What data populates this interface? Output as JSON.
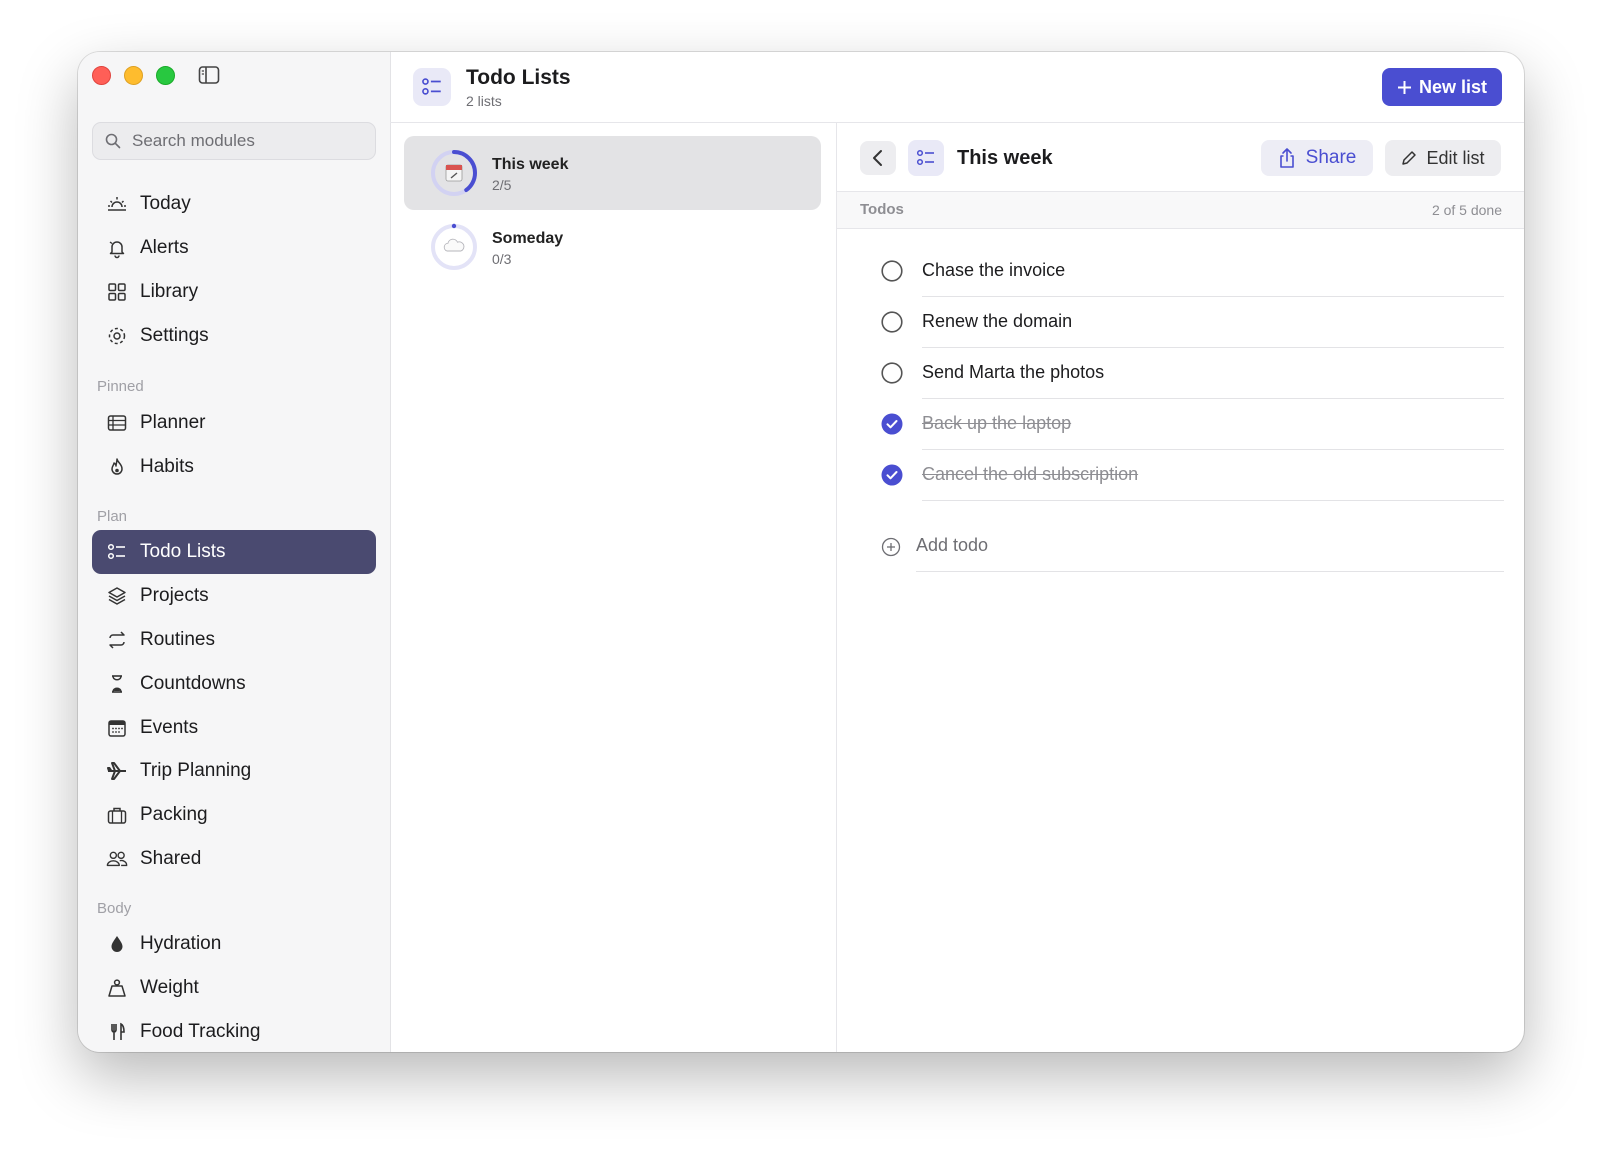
{
  "sidebar": {
    "search_placeholder": "Search modules",
    "top_items": [
      {
        "label": "Today",
        "icon": "sun-horizon-icon"
      },
      {
        "label": "Alerts",
        "icon": "bell-icon"
      },
      {
        "label": "Library",
        "icon": "grid-icon"
      },
      {
        "label": "Settings",
        "icon": "gear-icon"
      }
    ],
    "sections": {
      "pinned": "Pinned",
      "plan": "Plan",
      "body": "Body"
    },
    "pinned_items": [
      {
        "label": "Planner",
        "icon": "planner-icon"
      },
      {
        "label": "Habits",
        "icon": "flame-icon"
      }
    ],
    "plan_items": [
      {
        "label": "Todo Lists",
        "icon": "checklist-icon",
        "active": true
      },
      {
        "label": "Projects",
        "icon": "layers-icon"
      },
      {
        "label": "Routines",
        "icon": "repeat-icon"
      },
      {
        "label": "Countdowns",
        "icon": "hourglass-icon"
      },
      {
        "label": "Events",
        "icon": "calendar-icon"
      },
      {
        "label": "Trip Planning",
        "icon": "airplane-icon"
      },
      {
        "label": "Packing",
        "icon": "suitcase-icon"
      },
      {
        "label": "Shared",
        "icon": "people-icon"
      }
    ],
    "body_items": [
      {
        "label": "Hydration",
        "icon": "drop-icon"
      },
      {
        "label": "Weight",
        "icon": "weight-icon"
      },
      {
        "label": "Food Tracking",
        "icon": "fork-knife-icon"
      }
    ]
  },
  "header": {
    "title": "Todo Lists",
    "subtitle": "2 lists",
    "new_button": "New list",
    "accent": "#4a4ed1"
  },
  "lists": [
    {
      "name": "This week",
      "count": "2/5",
      "progress": 0.4,
      "selected": true
    },
    {
      "name": "Someday",
      "count": "0/3",
      "progress": 0.0,
      "selected": false
    }
  ],
  "detail": {
    "title": "This week",
    "share_label": "Share",
    "edit_label": "Edit list",
    "todos_label": "Todos",
    "done_summary": "2 of 5 done",
    "todos": [
      {
        "text": "Chase the invoice",
        "done": false
      },
      {
        "text": "Renew the domain",
        "done": false
      },
      {
        "text": "Send Marta the photos",
        "done": false
      },
      {
        "text": "Back up the laptop",
        "done": true
      },
      {
        "text": "Cancel the old subscription",
        "done": true
      }
    ],
    "add_label": "Add todo"
  }
}
